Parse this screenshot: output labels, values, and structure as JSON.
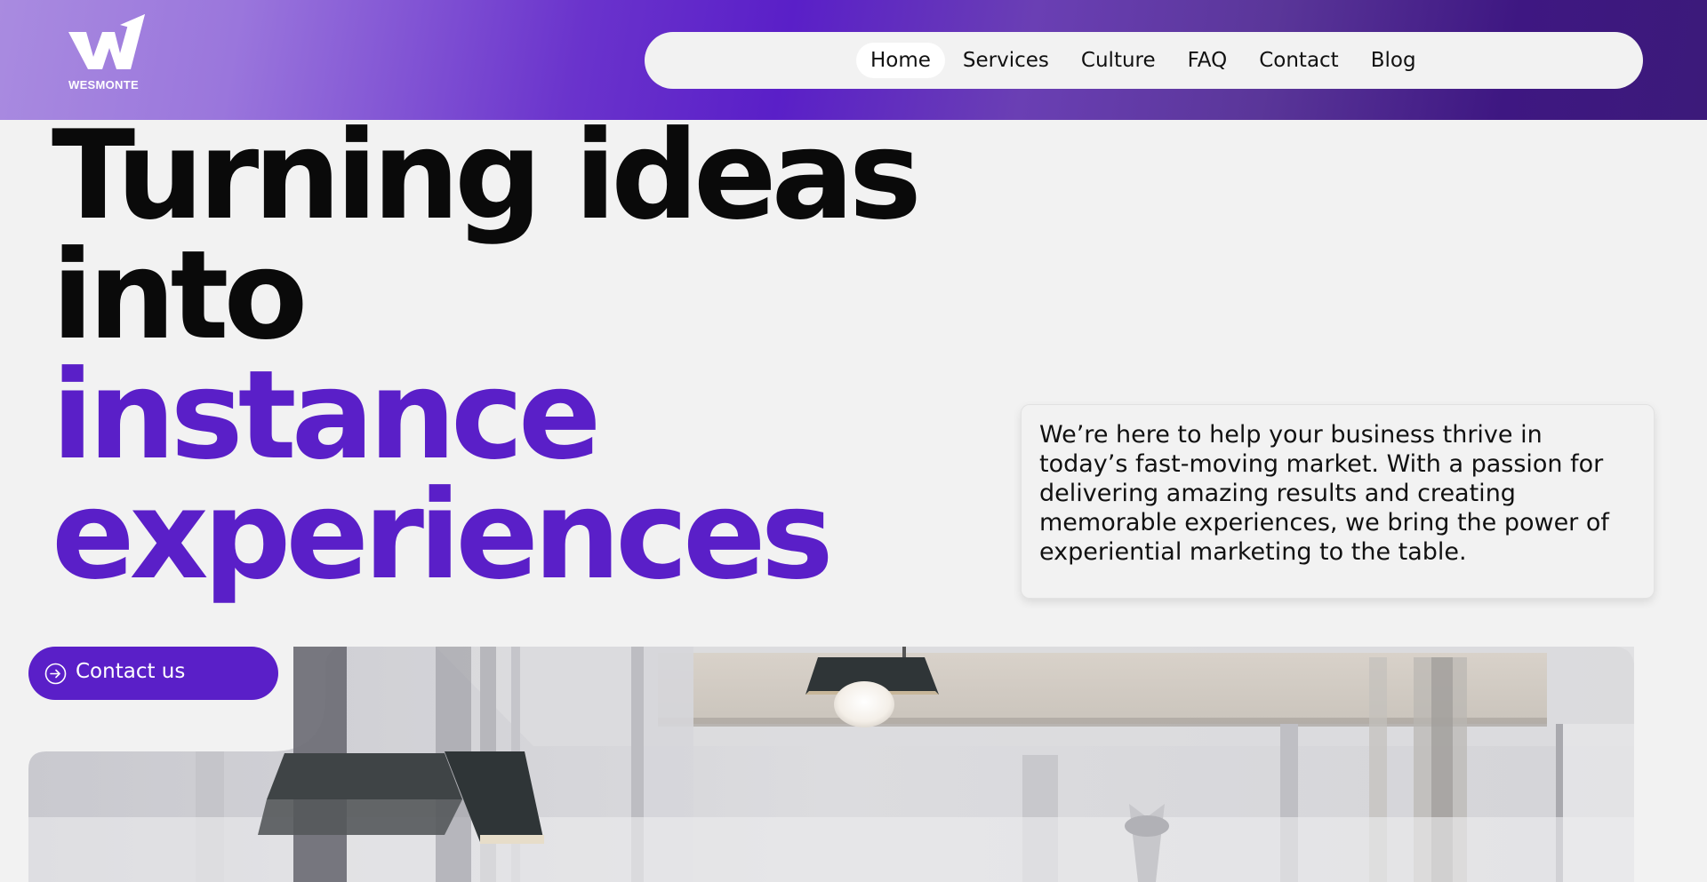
{
  "brand": {
    "logo_text": "WESMONTE",
    "icon": "wesmonte-w-logo"
  },
  "nav": {
    "items": [
      {
        "label": "Home",
        "active": true
      },
      {
        "label": "Services",
        "active": false
      },
      {
        "label": "Culture",
        "active": false
      },
      {
        "label": "FAQ",
        "active": false
      },
      {
        "label": "Contact",
        "active": false
      },
      {
        "label": "Blog",
        "active": false
      }
    ]
  },
  "hero": {
    "line1": "Turning ideas",
    "line2": "into",
    "line3": "instance",
    "line4": "experiences"
  },
  "intro": {
    "text": "We’re here to help your business thrive in today’s fast-moving market. With a passion for delivering amazing results and creating memorable experiences, we bring the power of experiential marketing to the table."
  },
  "cta": {
    "label": "Contact us",
    "icon": "arrow-circle-right-icon"
  },
  "colors": {
    "accent": "#5a1fc8",
    "background": "#f2f2f2",
    "header_start": "#a98be0",
    "header_end": "#3c1a7a"
  }
}
